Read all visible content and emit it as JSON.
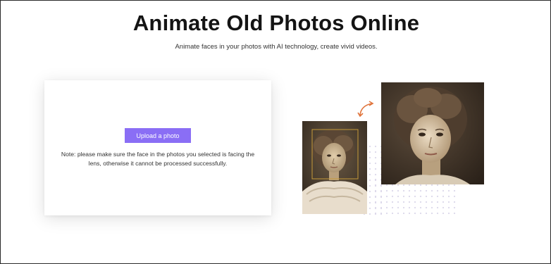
{
  "header": {
    "title": "Animate Old Photos Online",
    "subtitle": "Animate faces in your photos with AI technology, create vivid videos."
  },
  "upload_card": {
    "button_label": "Upload a photo",
    "note": "Note: please make sure the face in the photos you selected is facing the lens, otherwise it cannot be processed successfully."
  },
  "illustration": {
    "arrow_icon": "curved-double-arrow-icon",
    "arrow_color": "#e0733a",
    "dot_color": "#dcd8ea",
    "face_box_color": "#c59a3a"
  },
  "colors": {
    "accent": "#8a6ef5",
    "sepia_dark": "#3b2f24",
    "sepia_light": "#c9b38f"
  }
}
